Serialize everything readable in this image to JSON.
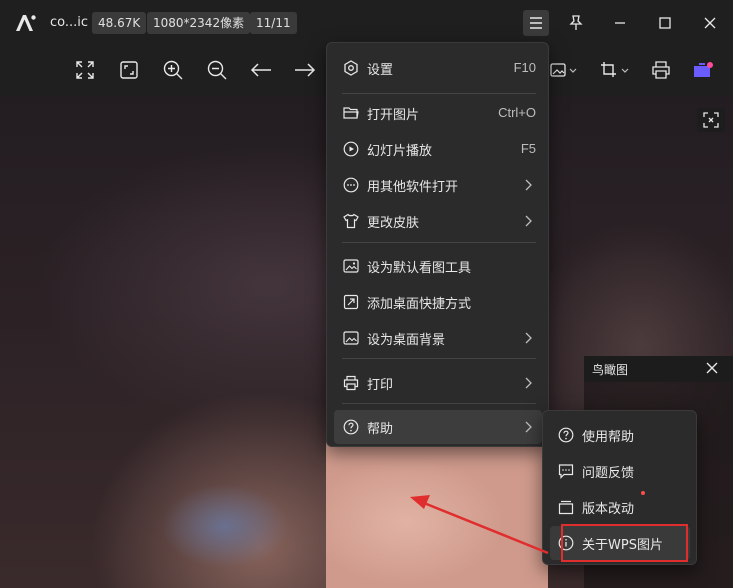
{
  "titlebar": {
    "filename": "co...ic",
    "size_badge": "48.67K",
    "dims_badge": "1080*2342像素",
    "index_badge": "11/11"
  },
  "menu": {
    "items": [
      {
        "label": "设置",
        "shortcut": "F10",
        "icon": "gear-icon"
      },
      {
        "label": "打开图片",
        "shortcut": "Ctrl+O",
        "icon": "folder-open-icon"
      },
      {
        "label": "幻灯片播放",
        "shortcut": "F5",
        "icon": "play-circle-icon"
      },
      {
        "label": "用其他软件打开",
        "icon": "more-circle-icon"
      },
      {
        "label": "更改皮肤",
        "icon": "shirt-icon"
      },
      {
        "label": "设为默认看图工具",
        "icon": "image-icon"
      },
      {
        "label": "添加桌面快捷方式",
        "icon": "shortcut-icon"
      },
      {
        "label": "设为桌面背景",
        "icon": "wallpaper-icon"
      },
      {
        "label": "打印",
        "icon": "printer-icon"
      },
      {
        "label": "帮助",
        "icon": "help-circle-icon"
      }
    ]
  },
  "submenu": {
    "items": [
      {
        "label": "使用帮助",
        "icon": "help-circle-icon"
      },
      {
        "label": "问题反馈",
        "icon": "feedback-icon"
      },
      {
        "label": "版本改动",
        "icon": "version-icon"
      },
      {
        "label": "关于WPS图片",
        "icon": "info-icon"
      }
    ]
  },
  "overview": {
    "title": "鸟瞰图"
  },
  "colors": {
    "accent_annotation": "#e02d2d",
    "menu_bg": "#2b2b2b",
    "titlebar_bg": "#1f1f1f"
  }
}
